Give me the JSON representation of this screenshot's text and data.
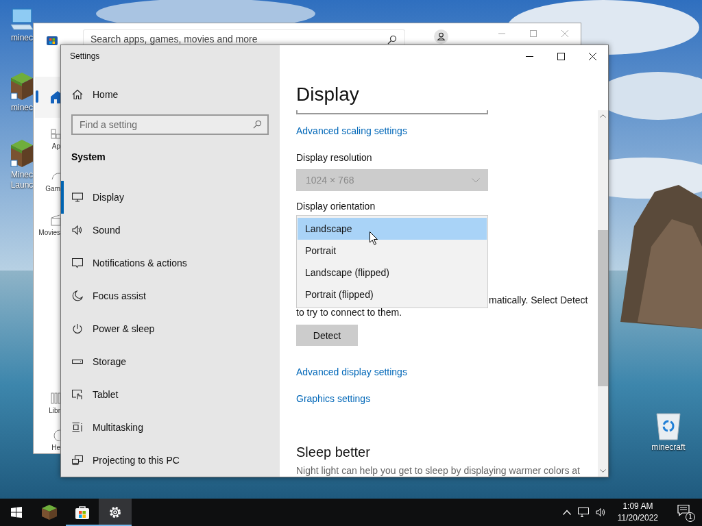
{
  "desktop": {
    "icons": [
      {
        "kind": "monitor",
        "label_lines": [
          "minec"
        ]
      },
      {
        "kind": "block",
        "label_lines": [
          "minec"
        ]
      },
      {
        "kind": "block",
        "label_lines": [
          "Minec",
          "Launc"
        ]
      },
      {
        "kind": "recycle-bin",
        "label_lines": [
          "minecraft"
        ]
      }
    ]
  },
  "store_window": {
    "search": {
      "placeholder": "Search apps, games, movies and more"
    },
    "nav": [
      {
        "kind": "home",
        "selected": true
      },
      {
        "kind": "apps",
        "label": "Ap",
        "selected": false
      },
      {
        "kind": "games",
        "label": "Gam",
        "selected": false
      },
      {
        "kind": "movies",
        "label": "Movies",
        "selected": false
      },
      {
        "kind": "library",
        "label": "Libr",
        "selected": false
      },
      {
        "kind": "help",
        "label": "He",
        "selected": false
      }
    ]
  },
  "settings_window": {
    "title": "Settings",
    "sidebar": {
      "home": "Home",
      "search": {
        "placeholder": "Find a setting"
      },
      "section": "System",
      "items": [
        {
          "kind": "display",
          "label": "Display",
          "selected": true
        },
        {
          "kind": "sound",
          "label": "Sound",
          "selected": false
        },
        {
          "kind": "notifications",
          "label": "Notifications & actions",
          "selected": false
        },
        {
          "kind": "focus",
          "label": "Focus assist",
          "selected": false
        },
        {
          "kind": "power",
          "label": "Power & sleep",
          "selected": false
        },
        {
          "kind": "storage",
          "label": "Storage",
          "selected": false
        },
        {
          "kind": "tablet",
          "label": "Tablet",
          "selected": false
        },
        {
          "kind": "multitasking",
          "label": "Multitasking",
          "selected": false
        },
        {
          "kind": "projecting",
          "label": "Projecting to this PC",
          "selected": false
        }
      ]
    },
    "content": {
      "title": "Display",
      "scaling_link": "Advanced scaling settings",
      "resolution": {
        "label": "Display resolution",
        "value": "1024 × 768",
        "disabled": true
      },
      "orientation": {
        "label": "Display orientation",
        "options": [
          {
            "label": "Landscape",
            "selected": true
          },
          {
            "label": "Portrait",
            "selected": false
          },
          {
            "label": "Landscape (flipped)",
            "selected": false
          },
          {
            "label": "Portrait (flipped)",
            "selected": false
          }
        ]
      },
      "detect_text_lines": [
        "matically. Select Detect",
        "to try to connect to them."
      ],
      "detect_button": "Detect",
      "links": [
        "Advanced display settings",
        "Graphics settings"
      ],
      "sleep": {
        "title": "Sleep better",
        "text": "Night light can help you get to sleep by displaying warmer colors at"
      }
    }
  },
  "taskbar": {
    "apps": [
      {
        "kind": "start",
        "running": false,
        "selected": false
      },
      {
        "kind": "minecraft",
        "running": false,
        "selected": false
      },
      {
        "kind": "store",
        "running": true,
        "selected": false
      },
      {
        "kind": "settings",
        "running": true,
        "selected": true
      }
    ],
    "tray": {
      "time": "1:09 AM",
      "date": "11/20/2022",
      "notification_count": "1"
    }
  }
}
